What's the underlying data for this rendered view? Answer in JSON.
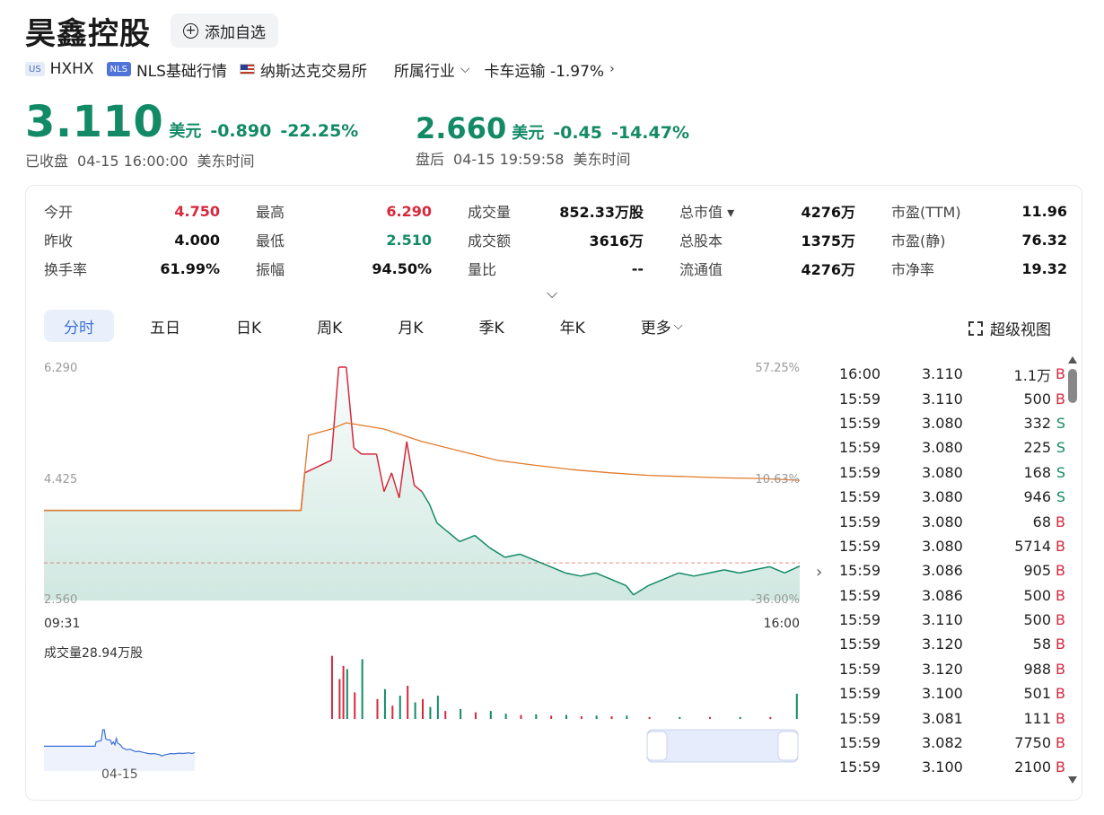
{
  "header": {
    "name": "昊鑫控股",
    "add_label": "添加自选",
    "market_tag": "US",
    "ticker": "HXHX",
    "nls_tag": "NLS",
    "nls_label": "NLS基础行情",
    "exchange": "纳斯达克交易所",
    "industry_label": "所属行业",
    "industry": "卡车运输 -1.97%"
  },
  "quote": {
    "price": "3.110",
    "unit": "美元",
    "change": "-0.890",
    "change_pct": "-22.25%",
    "status": "已收盘",
    "time": "04-15 16:00:00",
    "tz": "美东时间"
  },
  "after_hours": {
    "price": "2.660",
    "unit": "美元",
    "change": "-0.45",
    "change_pct": "-14.47%",
    "status": "盘后",
    "time": "04-15 19:59:58",
    "tz": "美东时间"
  },
  "stats": [
    {
      "label": "今开",
      "value": "4.750",
      "color": "red"
    },
    {
      "label": "昨收",
      "value": "4.000",
      "color": ""
    },
    {
      "label": "换手率",
      "value": "61.99%",
      "color": ""
    },
    {
      "label": "最高",
      "value": "6.290",
      "color": "red"
    },
    {
      "label": "最低",
      "value": "2.510",
      "color": "green"
    },
    {
      "label": "振幅",
      "value": "94.50%",
      "color": ""
    },
    {
      "label": "成交量",
      "value": "852.33万股",
      "color": ""
    },
    {
      "label": "成交额",
      "value": "3616万",
      "color": ""
    },
    {
      "label": "量比",
      "value": "--",
      "color": ""
    },
    {
      "label": "总市值 ▾",
      "value": "4276万",
      "color": ""
    },
    {
      "label": "总股本",
      "value": "1375万",
      "color": ""
    },
    {
      "label": "流通值",
      "value": "4276万",
      "color": ""
    },
    {
      "label": "市盈(TTM)",
      "value": "11.96",
      "color": ""
    },
    {
      "label": "市盈(静)",
      "value": "76.32",
      "color": ""
    },
    {
      "label": "市净率",
      "value": "19.32",
      "color": ""
    }
  ],
  "tabs": [
    "分时",
    "五日",
    "日K",
    "周K",
    "月K",
    "季K",
    "年K",
    "更多"
  ],
  "super_view": "超级视图",
  "chart_data": {
    "type": "line",
    "y_left_ticks": [
      "6.290",
      "4.425",
      "2.560"
    ],
    "y_right_ticks": [
      "57.25%",
      "10.63%",
      "-36.00%"
    ],
    "ylim": [
      2.56,
      6.29
    ],
    "prev_close": 4.0,
    "x_start": "09:31",
    "x_end": "16:00",
    "volume_label": "成交量28.94万股",
    "mini_date": "04-15",
    "series": [
      {
        "type": "price",
        "points": [
          [
            0,
            4.0
          ],
          [
            0.34,
            4.0
          ],
          [
            0.345,
            4.6
          ],
          [
            0.38,
            4.8
          ],
          [
            0.39,
            6.29
          ],
          [
            0.4,
            6.29
          ],
          [
            0.41,
            5.0
          ],
          [
            0.42,
            4.9
          ],
          [
            0.44,
            4.9
          ],
          [
            0.45,
            4.3
          ],
          [
            0.46,
            4.6
          ],
          [
            0.47,
            4.2
          ],
          [
            0.48,
            5.1
          ],
          [
            0.49,
            4.4
          ],
          [
            0.5,
            4.3
          ],
          [
            0.51,
            4.1
          ],
          [
            0.52,
            3.8
          ],
          [
            0.53,
            3.7
          ],
          [
            0.55,
            3.5
          ],
          [
            0.57,
            3.6
          ],
          [
            0.59,
            3.4
          ],
          [
            0.61,
            3.25
          ],
          [
            0.63,
            3.3
          ],
          [
            0.65,
            3.2
          ],
          [
            0.67,
            3.1
          ],
          [
            0.69,
            3.0
          ],
          [
            0.71,
            2.95
          ],
          [
            0.73,
            3.0
          ],
          [
            0.75,
            2.9
          ],
          [
            0.77,
            2.8
          ],
          [
            0.78,
            2.65
          ],
          [
            0.8,
            2.8
          ],
          [
            0.82,
            2.9
          ],
          [
            0.84,
            3.0
          ],
          [
            0.86,
            2.95
          ],
          [
            0.88,
            3.0
          ],
          [
            0.9,
            3.05
          ],
          [
            0.92,
            3.0
          ],
          [
            0.94,
            3.05
          ],
          [
            0.96,
            3.1
          ],
          [
            0.98,
            3.0
          ],
          [
            1.0,
            3.11
          ]
        ]
      },
      {
        "type": "avg",
        "points": [
          [
            0,
            4.0
          ],
          [
            0.34,
            4.0
          ],
          [
            0.35,
            5.2
          ],
          [
            0.38,
            5.3
          ],
          [
            0.4,
            5.4
          ],
          [
            0.45,
            5.3
          ],
          [
            0.5,
            5.1
          ],
          [
            0.55,
            4.95
          ],
          [
            0.6,
            4.8
          ],
          [
            0.65,
            4.72
          ],
          [
            0.7,
            4.65
          ],
          [
            0.75,
            4.6
          ],
          [
            0.8,
            4.56
          ],
          [
            0.85,
            4.54
          ],
          [
            0.9,
            4.52
          ],
          [
            0.95,
            4.51
          ],
          [
            1.0,
            4.48
          ]
        ]
      }
    ]
  },
  "ticks": [
    {
      "time": "16:00",
      "price": "3.110",
      "vol": "1.1万",
      "dir": "B"
    },
    {
      "time": "15:59",
      "price": "3.110",
      "vol": "500",
      "dir": "B"
    },
    {
      "time": "15:59",
      "price": "3.080",
      "vol": "332",
      "dir": "S"
    },
    {
      "time": "15:59",
      "price": "3.080",
      "vol": "225",
      "dir": "S"
    },
    {
      "time": "15:59",
      "price": "3.080",
      "vol": "168",
      "dir": "S"
    },
    {
      "time": "15:59",
      "price": "3.080",
      "vol": "946",
      "dir": "S"
    },
    {
      "time": "15:59",
      "price": "3.080",
      "vol": "68",
      "dir": "B"
    },
    {
      "time": "15:59",
      "price": "3.080",
      "vol": "5714",
      "dir": "B"
    },
    {
      "time": "15:59",
      "price": "3.086",
      "vol": "905",
      "dir": "B"
    },
    {
      "time": "15:59",
      "price": "3.086",
      "vol": "500",
      "dir": "B"
    },
    {
      "time": "15:59",
      "price": "3.110",
      "vol": "500",
      "dir": "B"
    },
    {
      "time": "15:59",
      "price": "3.120",
      "vol": "58",
      "dir": "B"
    },
    {
      "time": "15:59",
      "price": "3.120",
      "vol": "988",
      "dir": "B"
    },
    {
      "time": "15:59",
      "price": "3.100",
      "vol": "501",
      "dir": "B"
    },
    {
      "time": "15:59",
      "price": "3.081",
      "vol": "111",
      "dir": "B"
    },
    {
      "time": "15:59",
      "price": "3.082",
      "vol": "7750",
      "dir": "B"
    },
    {
      "time": "15:59",
      "price": "3.100",
      "vol": "2100",
      "dir": "B"
    }
  ],
  "colors": {
    "up": "#d6293d",
    "down": "#138a66",
    "avg": "#e07b2a",
    "accent": "#3b6fd9"
  }
}
